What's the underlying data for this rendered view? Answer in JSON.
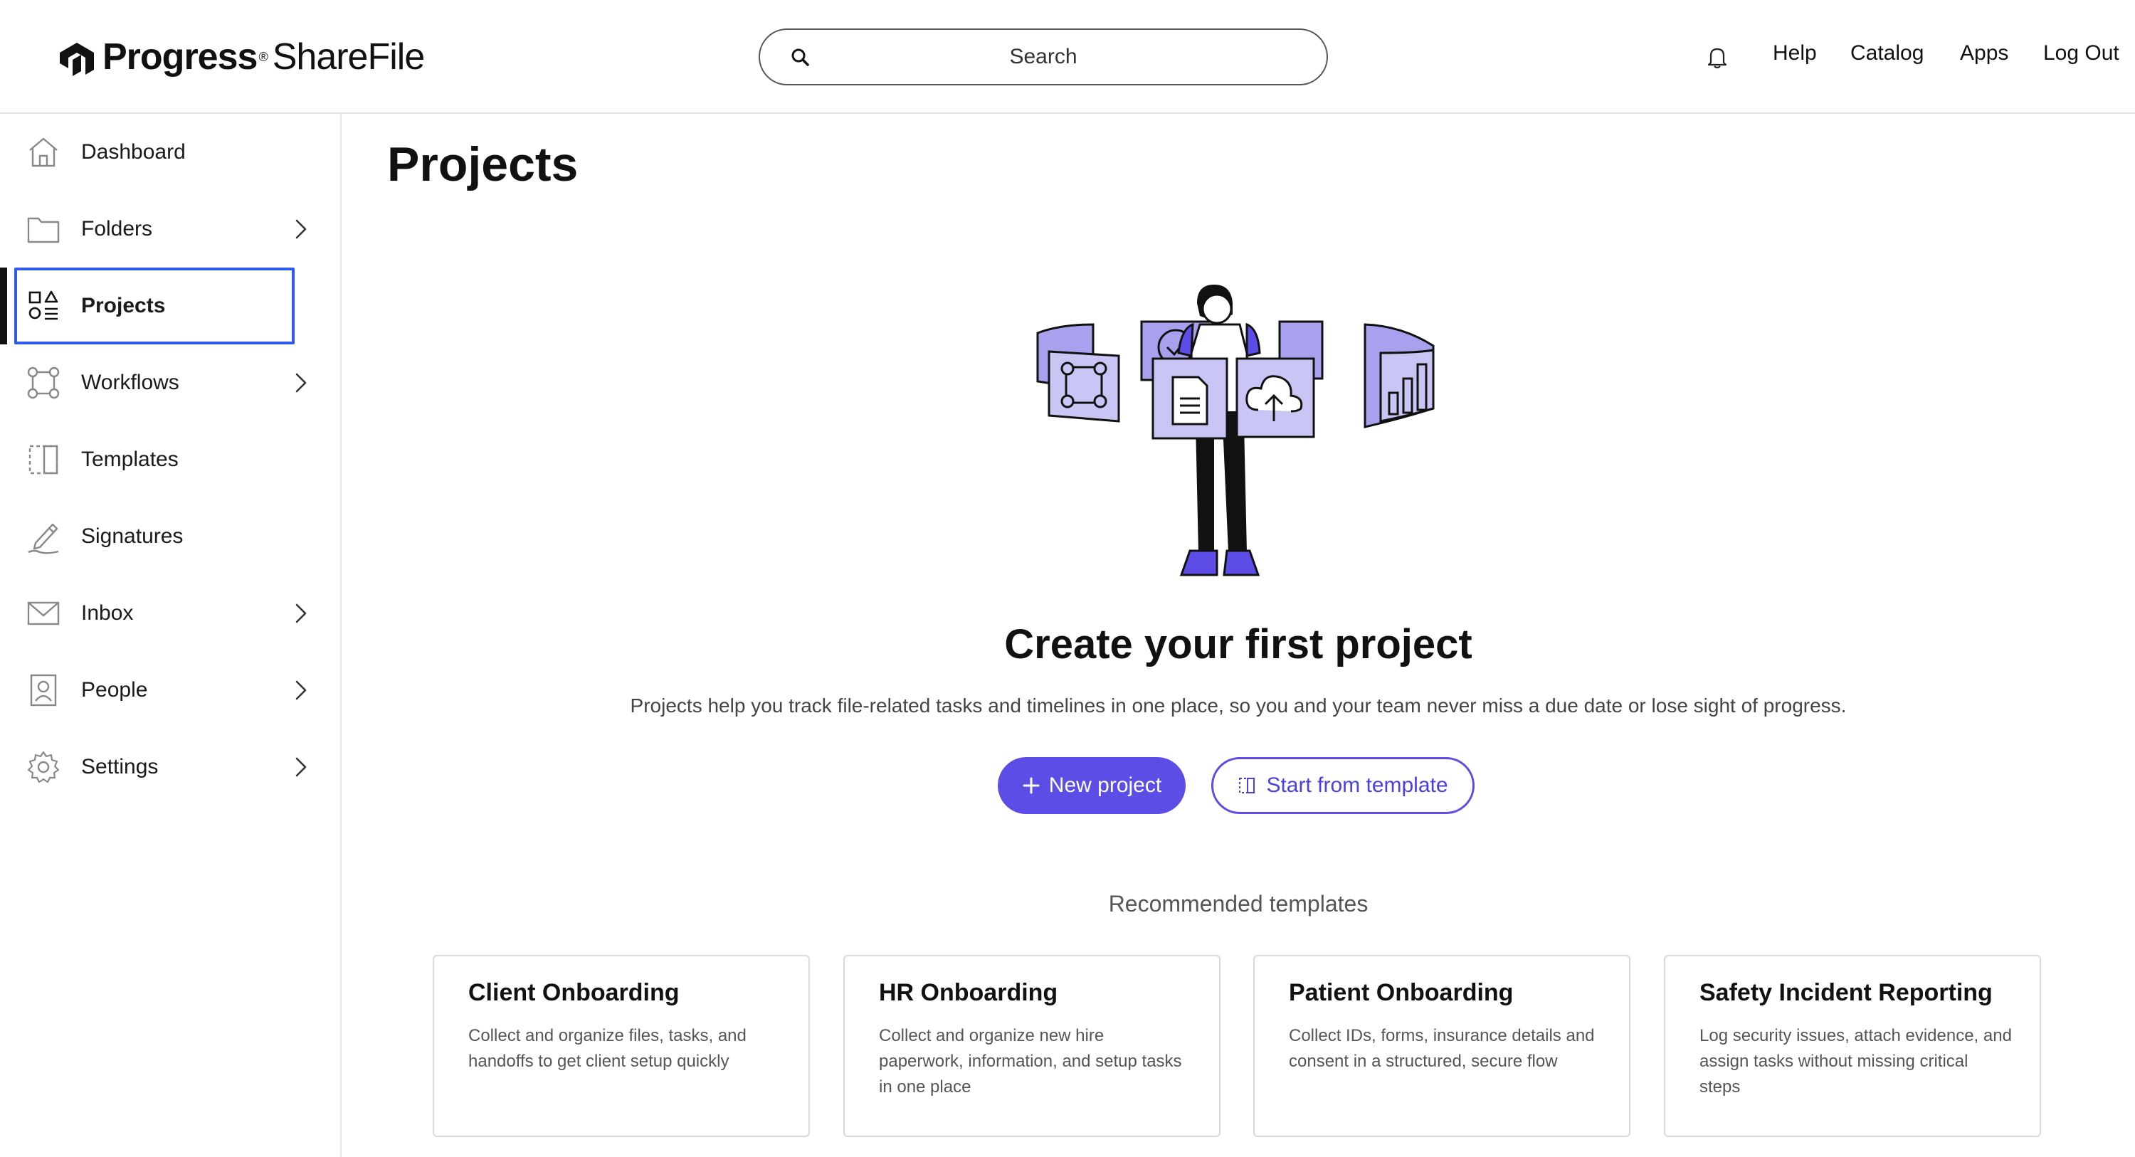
{
  "header": {
    "logo_word": "Progress",
    "logo_word2": "ShareFile",
    "logo_mark": "®",
    "search_placeholder": "Search",
    "links": [
      "Help",
      "Catalog",
      "Apps",
      "Log Out"
    ]
  },
  "sidebar": {
    "items": [
      {
        "label": "Dashboard",
        "icon": "home-icon",
        "chevron": false
      },
      {
        "label": "Folders",
        "icon": "folder-icon",
        "chevron": true
      },
      {
        "label": "Projects",
        "icon": "projects-icon",
        "chevron": false,
        "active": true
      },
      {
        "label": "Workflows",
        "icon": "workflow-icon",
        "chevron": true
      },
      {
        "label": "Templates",
        "icon": "template-icon",
        "chevron": false
      },
      {
        "label": "Signatures",
        "icon": "pen-icon",
        "chevron": false
      },
      {
        "label": "Inbox",
        "icon": "mail-icon",
        "chevron": true
      },
      {
        "label": "People",
        "icon": "person-icon",
        "chevron": true
      },
      {
        "label": "Settings",
        "icon": "gear-icon",
        "chevron": true
      }
    ]
  },
  "main": {
    "title": "Projects",
    "headline": "Create your first project",
    "subtext": "Projects help you track file-related tasks and timelines in one place, so you and your team never miss a due date or lose sight of progress.",
    "new_project_label": "New project",
    "template_label": "Start from template",
    "recommended_title": "Recommended templates",
    "cards": [
      {
        "title": "Client Onboarding",
        "desc": "Collect and organize files, tasks, and handoffs to get client setup quickly"
      },
      {
        "title": "HR Onboarding",
        "desc": "Collect and organize new hire paperwork, information, and setup tasks in one place"
      },
      {
        "title": "Patient Onboarding",
        "desc": "Collect IDs, forms, insurance details and consent in a structured, secure flow"
      },
      {
        "title": "Safety Incident Reporting",
        "desc": "Log security issues, attach evidence, and assign tasks without missing critical steps"
      }
    ]
  },
  "colors": {
    "accent": "#5b4de6",
    "focus_outline": "#2f5bea",
    "illustration_light": "#c9c6f5",
    "illustration_mid": "#a8a2ee"
  }
}
